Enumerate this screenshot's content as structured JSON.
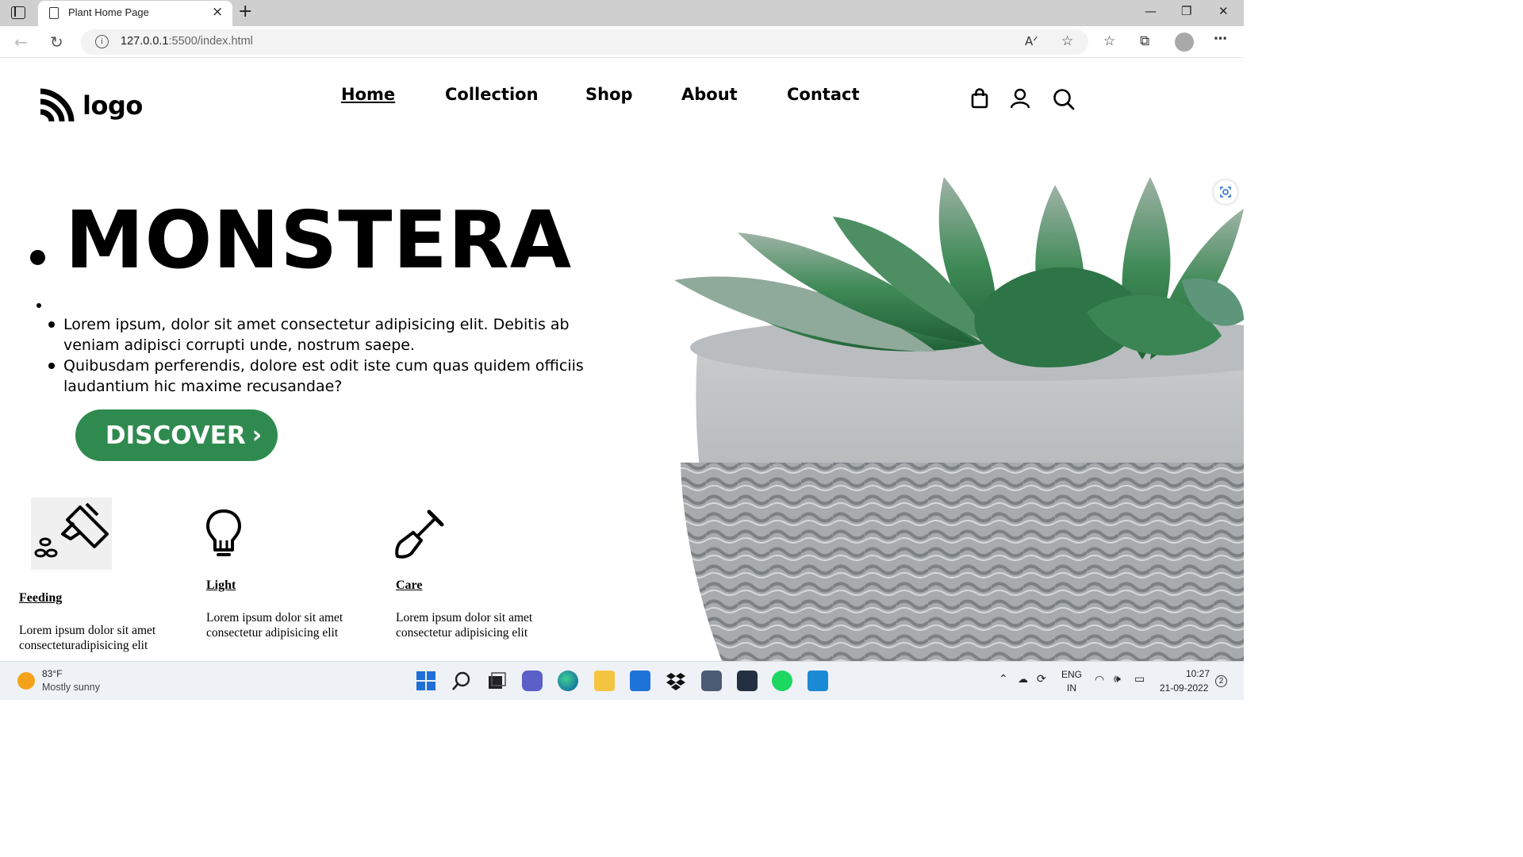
{
  "browser": {
    "tab_title": "Plant Home Page",
    "tab_close": "×",
    "new_tab": "+",
    "url_host": "127.0.0.1",
    "url_rest": ":5500/index.html",
    "window_controls": {
      "minimize": "—",
      "maximize": "❐",
      "close": "✕"
    }
  },
  "site": {
    "logo_text": "logo",
    "nav": [
      {
        "label": "Home",
        "active": true
      },
      {
        "label": "Collection",
        "active": false
      },
      {
        "label": "Shop",
        "active": false
      },
      {
        "label": "About",
        "active": false
      },
      {
        "label": "Contact",
        "active": false
      }
    ],
    "header_icons": [
      "shopping-bag-icon",
      "user-icon",
      "search-icon"
    ]
  },
  "hero": {
    "title": "MONSTERA",
    "paragraphs": [
      "Lorem ipsum, dolor sit amet consectetur adipisicing elit. Debitis ab veniam adipisci corrupti unde, nostrum saepe.",
      "Quibusdam perferendis, dolore est odit iste cum quas quidem officiis laudantium hic maxime recusandae?"
    ],
    "cta_label": "DISCOVER",
    "cta_color": "#2f8a4f"
  },
  "features": [
    {
      "title": "Feeding",
      "text": "Lorem ipsum dolor sit amet consecteturadipisicing elit",
      "icon": "watering-can-icon"
    },
    {
      "title": "Light",
      "text": "Lorem ipsum dolor sit amet consectetur adipisicing elit",
      "icon": "lightbulb-icon"
    },
    {
      "title": "Care",
      "text": "Lorem ipsum dolor sit amet consectetur adipisicing elit",
      "icon": "shovel-icon"
    }
  ],
  "taskbar": {
    "weather_temp": "83°F",
    "weather_desc": "Mostly sunny",
    "lang_top": "ENG",
    "lang_bottom": "IN",
    "time": "10:27",
    "date": "21-09-2022",
    "notification_count": "2"
  }
}
